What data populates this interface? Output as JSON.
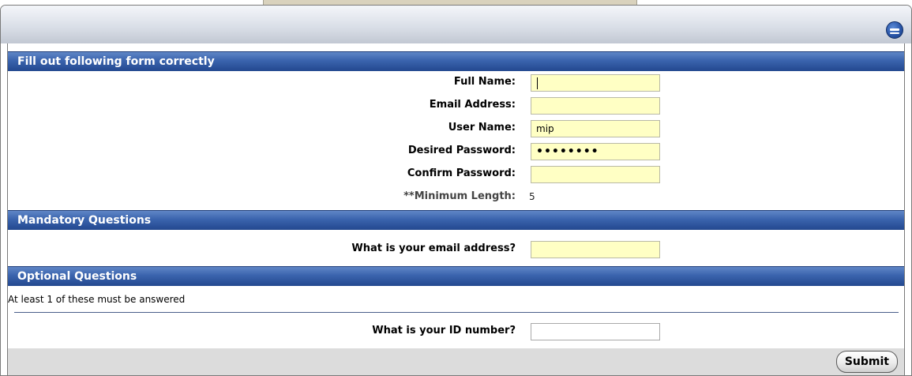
{
  "window": {
    "collapse_icon": "collapse-icon"
  },
  "sections": {
    "account": {
      "title": "Fill out following form correctly"
    },
    "mandatory": {
      "title": "Mandatory Questions"
    },
    "optional": {
      "title": "Optional Questions"
    }
  },
  "fields": {
    "full_name": {
      "label": "Full Name:",
      "value": ""
    },
    "email": {
      "label": "Email Address:",
      "value": ""
    },
    "user_name": {
      "label": "User Name:",
      "value": "mip"
    },
    "password": {
      "label": "Desired Password:",
      "value": "••••••••"
    },
    "confirm": {
      "label": "Confirm Password:",
      "value": ""
    },
    "min_length": {
      "label": "**Minimum Length:",
      "value": "5"
    }
  },
  "mandatory": {
    "q1": {
      "label": "What is your email address?",
      "value": ""
    }
  },
  "optional": {
    "note": "At least 1 of these must be answered",
    "q1": {
      "label": "What is your ID number?",
      "value": ""
    }
  },
  "footer": {
    "submit_label": "Submit"
  },
  "colors": {
    "header_blue": "#3a63ad",
    "field_yellow": "#ffffc4",
    "footer_gray": "#dcdcdc"
  }
}
